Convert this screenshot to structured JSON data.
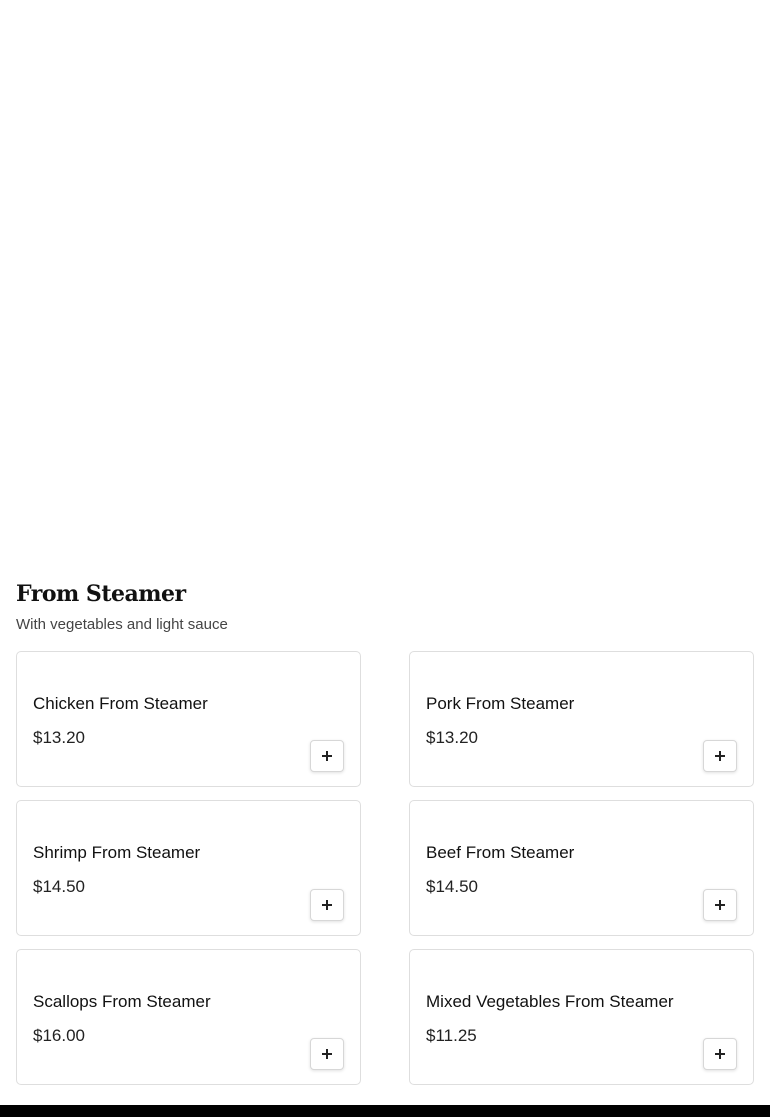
{
  "section": {
    "title": "From Steamer",
    "subtitle": "With vegetables and light sauce"
  },
  "items": [
    {
      "name": "Chicken From Steamer",
      "price": "$13.20"
    },
    {
      "name": "Pork From Steamer",
      "price": "$13.20"
    },
    {
      "name": "Shrimp From Steamer",
      "price": "$14.50"
    },
    {
      "name": "Beef From Steamer",
      "price": "$14.50"
    },
    {
      "name": "Scallops From Steamer",
      "price": "$16.00"
    },
    {
      "name": "Mixed Vegetables From Steamer",
      "price": "$11.25"
    }
  ],
  "icons": {
    "add": "plus-icon"
  }
}
